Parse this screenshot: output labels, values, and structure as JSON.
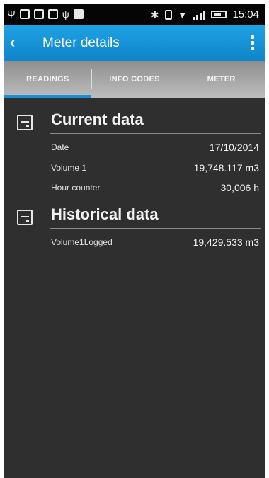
{
  "status_bar": {
    "time": "15:04",
    "icons": [
      "signal-icon",
      "message-icon",
      "image-icon",
      "image-icon",
      "usb-icon",
      "notification-icon",
      "bluetooth-icon",
      "vibrate-icon",
      "wifi-icon",
      "cell-signal-icon",
      "battery-icon"
    ]
  },
  "action_bar": {
    "title": "Meter details",
    "color": "#1a94d6"
  },
  "tabs": [
    {
      "label": "READINGS",
      "active": true
    },
    {
      "label": "INFO CODES",
      "active": false
    },
    {
      "label": "METER",
      "active": false
    }
  ],
  "current": {
    "title": "Current data",
    "rows": [
      {
        "label": "Date",
        "value": "17/10/2014"
      },
      {
        "label": "Volume 1",
        "value": "19,748.117 m3"
      },
      {
        "label": "Hour counter",
        "value": "30,006 h"
      }
    ]
  },
  "historical": {
    "title": "Historical data",
    "rows": [
      {
        "label": "Volume1Logged",
        "value": "19,429.533 m3"
      }
    ]
  }
}
